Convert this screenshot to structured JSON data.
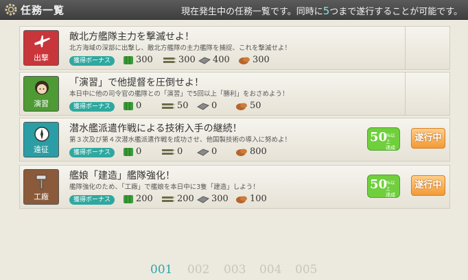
{
  "header": {
    "title": "任務一覧",
    "note_pre": "現在発生中の任務一覧です。同時に",
    "note_num": "5",
    "note_post": "つまで遂行することが可能です。"
  },
  "quests": [
    {
      "category": "出撃",
      "category_color": "#c8353a",
      "title": "敵北方艦隊主力を撃滅せよ！",
      "description": "北方海域の深部に出撃し、敵北方艦隊の主力艦隊を捕捉、これを撃滅せよ！",
      "bonus_label": "獲得ボーナス",
      "fuel": "300",
      "ammo": "300",
      "steel": "400",
      "bauxite": "300",
      "progress": "",
      "status": ""
    },
    {
      "category": "演習",
      "category_color": "#4e9a35",
      "title": "「演習」で他提督を圧倒せよ！",
      "description": "本日中に他の司令官の艦隊との「演習」で5回以上「勝利」をおさめよう！",
      "bonus_label": "獲得ボーナス",
      "fuel": "0",
      "ammo": "50",
      "steel": "0",
      "bauxite": "50",
      "progress": "",
      "status": ""
    },
    {
      "category": "遠征",
      "category_color": "#2a9ea4",
      "title": "潜水艦派遣作戦による技術入手の継続！",
      "description": "第３次及び第４次潜水艦派遣作戦を成功させ、他国製技術の導入に努めよ！",
      "bonus_label": "獲得ボーナス",
      "fuel": "0",
      "ammo": "0",
      "steel": "0",
      "bauxite": "800",
      "progress": "50%以上達成",
      "status": "遂行中"
    },
    {
      "category": "工廠",
      "category_color": "#8a5a3a",
      "title": "艦娘「建造」艦隊強化！",
      "description": "艦隊強化のため、「工廠」で艦娘を本日中に3隻「建造」しよう！",
      "bonus_label": "獲得ボーナス",
      "fuel": "200",
      "ammo": "200",
      "steel": "300",
      "bauxite": "100",
      "progress": "50%以上達成",
      "status": "遂行中"
    }
  ],
  "progress_parts": {
    "num": "50",
    "line1": "%以上",
    "line2": "達成"
  },
  "pager": [
    "001",
    "002",
    "003",
    "004",
    "005"
  ],
  "colors": {
    "fuel": "#3c9b3a",
    "ammo": "#6d6a4a",
    "steel": "#8a8a8a",
    "bauxite": "#b5652d",
    "accent": "#2aa7a7",
    "in_progress": "#f39a35",
    "progress_badge": "#6fcf3c"
  }
}
